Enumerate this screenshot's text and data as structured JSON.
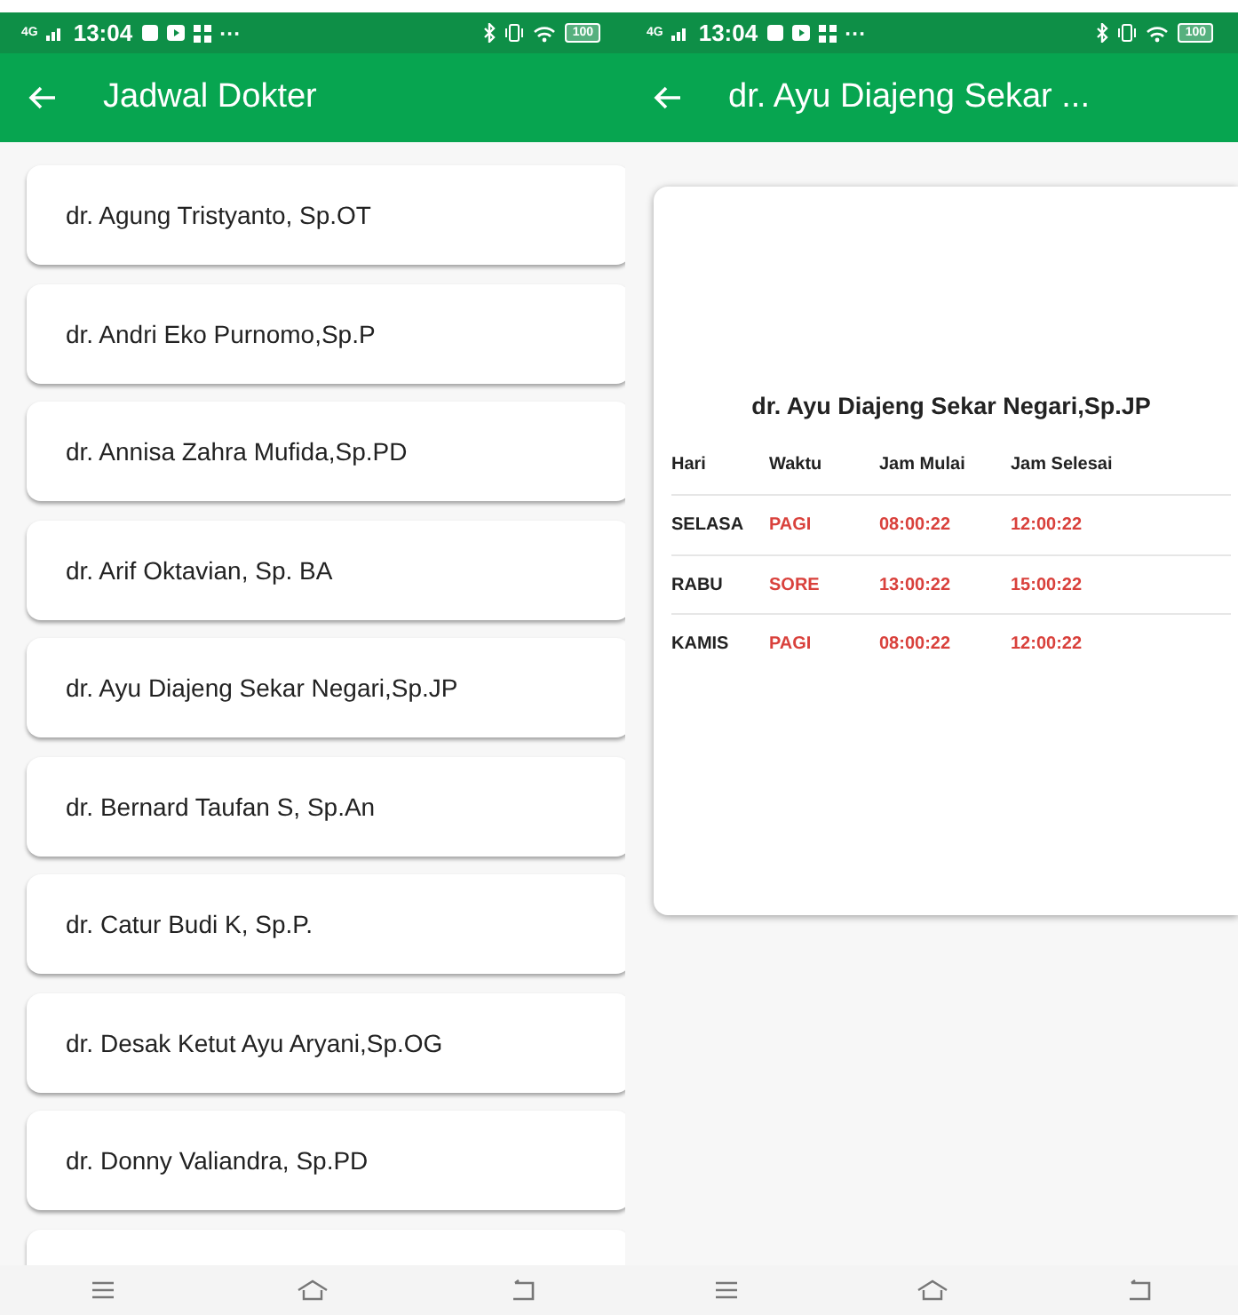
{
  "screens": [
    {
      "status_bar": {
        "network": "4G",
        "time": "13:04",
        "more": "···",
        "battery": "100"
      },
      "app_bar": {
        "title": "Jadwal Dokter"
      },
      "doctors": [
        "dr. Agung  Tristyanto, Sp.OT",
        "dr. Andri Eko Purnomo,Sp.P",
        "dr. Annisa Zahra Mufida,Sp.PD",
        "dr. Arif Oktavian, Sp. BA",
        "dr. Ayu Diajeng Sekar Negari,Sp.JP",
        "dr. Bernard Taufan S, Sp.An",
        "dr. Catur Budi K, Sp.P.",
        "dr. Desak Ketut Ayu Aryani,Sp.OG",
        "dr. Donny Valiandra, Sp.PD"
      ]
    },
    {
      "status_bar": {
        "network": "4G",
        "time": "13:04",
        "more": "···",
        "battery": "100"
      },
      "app_bar": {
        "title": "dr. Ayu Diajeng Sekar ..."
      },
      "schedule": {
        "doctor": "dr. Ayu Diajeng Sekar Negari,Sp.JP",
        "columns": [
          "Hari",
          "Waktu",
          "Jam Mulai",
          "Jam Selesai"
        ],
        "rows": [
          [
            "SELASA",
            "PAGI",
            "08:00:22",
            "12:00:22"
          ],
          [
            "RABU",
            "SORE",
            "13:00:22",
            "15:00:22"
          ],
          [
            "KAMIS",
            "PAGI",
            "08:00:22",
            "12:00:22"
          ]
        ]
      }
    }
  ]
}
